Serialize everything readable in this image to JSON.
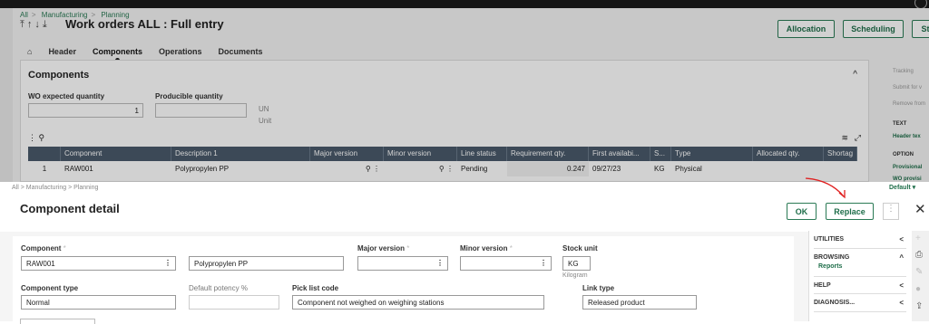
{
  "bg": {
    "breadcrumb": [
      "All",
      "Manufacturing",
      "Planning"
    ],
    "title": "Work orders ALL : Full entry",
    "buttons": [
      "Allocation",
      "Scheduling",
      "St"
    ],
    "tabs": [
      "Header",
      "Components",
      "Operations",
      "Documents"
    ],
    "panel": {
      "title": "Components",
      "wo_expected_label": "WO expected quantity",
      "wo_expected_value": "1",
      "producible_label": "Producible quantity",
      "un": "UN",
      "unit": "Unit"
    },
    "table": {
      "columns": [
        "Component",
        "Description 1",
        "Major version",
        "Minor version",
        "Line status",
        "Requirement qty.",
        "First availabi...",
        "S...",
        "Type",
        "Allocated qty.",
        "Shortag"
      ],
      "row": [
        "1",
        "RAW001",
        "Polypropylen PP",
        "Pending",
        "0.247",
        "09/27/23",
        "KG",
        "Physical"
      ]
    },
    "right": [
      "Tracking",
      "Submit for v",
      "Remove from",
      "TEXT",
      "Header tex",
      "OPTION",
      "Provisional",
      "WO provisi"
    ]
  },
  "modal": {
    "breadcrumb": [
      "All",
      "Manufacturing",
      "Planning"
    ],
    "default_label": "Default",
    "title": "Component detail",
    "ok": "OK",
    "replace": "Replace",
    "fields": {
      "component_label": "Component",
      "component_value": "RAW001",
      "description_value": "Polypropylen PP",
      "major_label": "Major version",
      "minor_label": "Minor version",
      "stock_unit_label": "Stock unit",
      "stock_unit_value": "KG",
      "stock_unit_caption": "Kilogram",
      "type_label": "Component type",
      "type_value": "Normal",
      "potency_label": "Default potency %",
      "picklist_label": "Pick list code",
      "picklist_value": "Component not weighed on weighing stations",
      "link_label": "Link type",
      "link_value": "Released product"
    }
  },
  "side": {
    "utilities": "UTILITIES",
    "browsing": "BROWSING",
    "reports": "Reports",
    "help": "HELP",
    "diagnosis": "DIAGNOSIS..."
  },
  "colors": {
    "accent": "#1f6e4a",
    "table_header": "#4a5a6b",
    "annotation": "#e02020"
  }
}
